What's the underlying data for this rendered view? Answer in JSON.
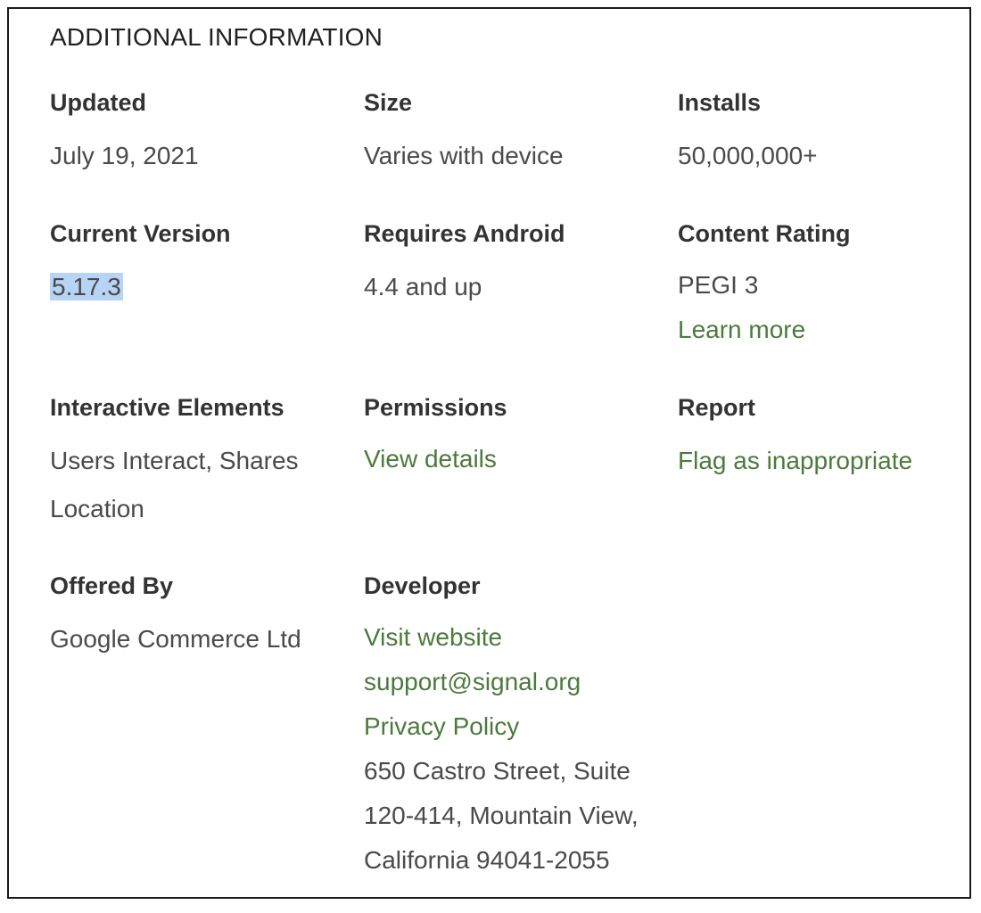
{
  "section_title": "ADDITIONAL INFORMATION",
  "colors": {
    "link": "#4b7a3c",
    "selection": "#b7d3f5",
    "label": "#333333",
    "value": "#4a4a4a"
  },
  "updated": {
    "label": "Updated",
    "value": "July 19, 2021"
  },
  "size": {
    "label": "Size",
    "value": "Varies with device"
  },
  "installs": {
    "label": "Installs",
    "value": "50,000,000+"
  },
  "current_version": {
    "label": "Current Version",
    "value": "5.17.3"
  },
  "requires_android": {
    "label": "Requires Android",
    "value": "4.4 and up"
  },
  "content_rating": {
    "label": "Content Rating",
    "value": "PEGI 3",
    "link": "Learn more"
  },
  "interactive_elements": {
    "label": "Interactive Elements",
    "value_line1": "Users Interact, Shares",
    "value_line2": "Location"
  },
  "permissions": {
    "label": "Permissions",
    "link": "View details"
  },
  "report": {
    "label": "Report",
    "link": "Flag as inappropriate"
  },
  "offered_by": {
    "label": "Offered By",
    "value": "Google Commerce Ltd"
  },
  "developer": {
    "label": "Developer",
    "website_link": "Visit website",
    "email_link": "support@signal.org",
    "privacy_link": "Privacy Policy",
    "address_line1": "650 Castro Street, Suite",
    "address_line2": "120-414, Mountain View,",
    "address_line3": "California 94041-2055"
  }
}
